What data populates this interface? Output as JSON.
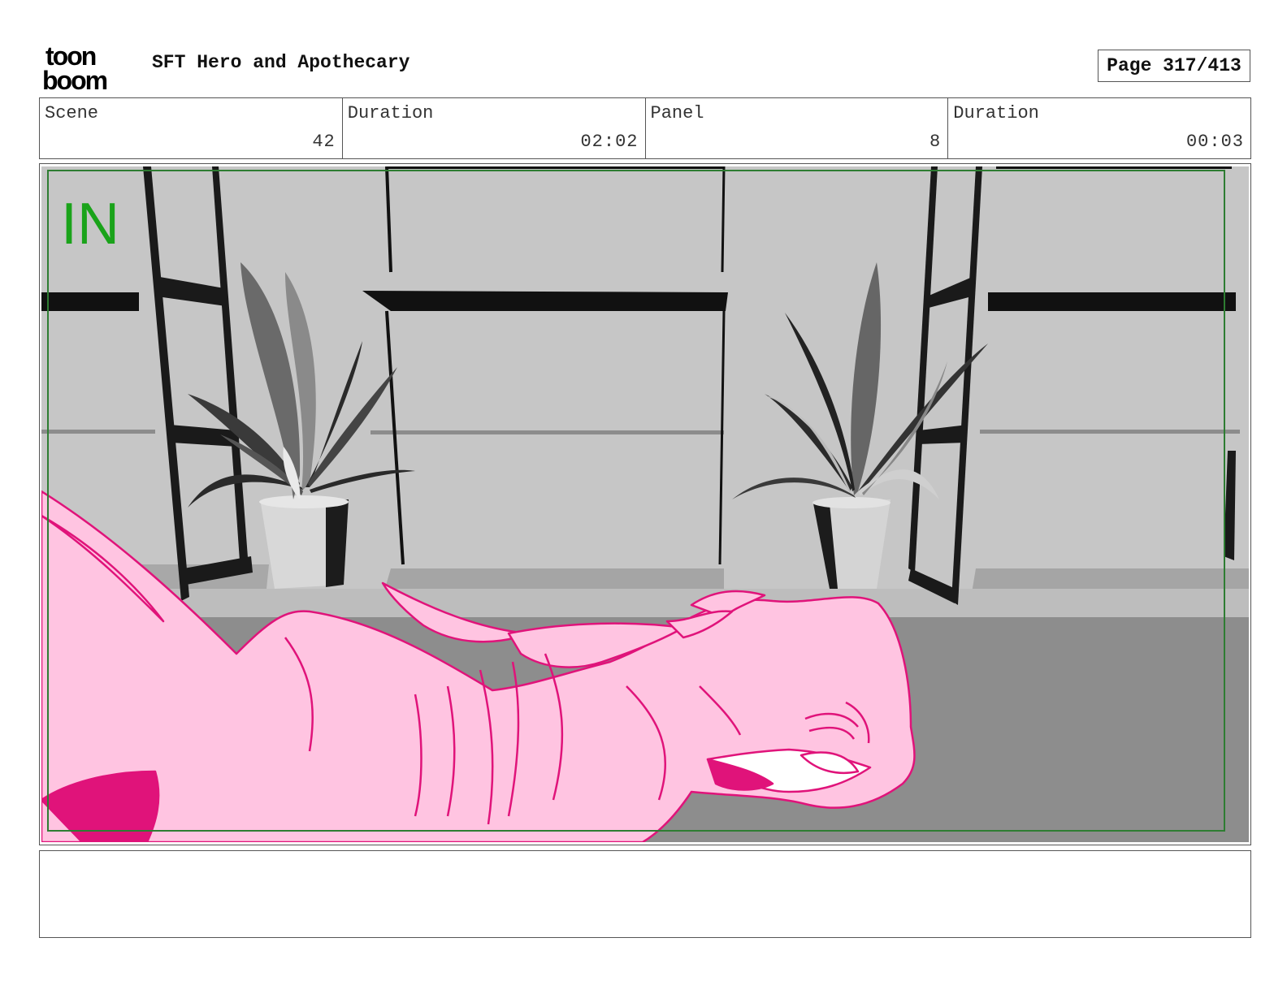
{
  "header": {
    "logo_text_top": "toon",
    "logo_text_bottom": "boom",
    "title": "SFT Hero and Apothecary",
    "page_label": "Page 317/413"
  },
  "info": {
    "scene_label": "Scene",
    "scene_value": "42",
    "scene_duration_label": "Duration",
    "scene_duration_value": "02:02",
    "panel_label": "Panel",
    "panel_value": "8",
    "panel_duration_label": "Duration",
    "panel_duration_value": "00:03"
  },
  "panel": {
    "overlay_text": "IN",
    "overlay_color": "#1aa31a",
    "safe_frame_color": "#2e7d32",
    "character_fill": "#ffc4e1",
    "character_line": "#e0137a"
  },
  "notes": {
    "text": ""
  }
}
